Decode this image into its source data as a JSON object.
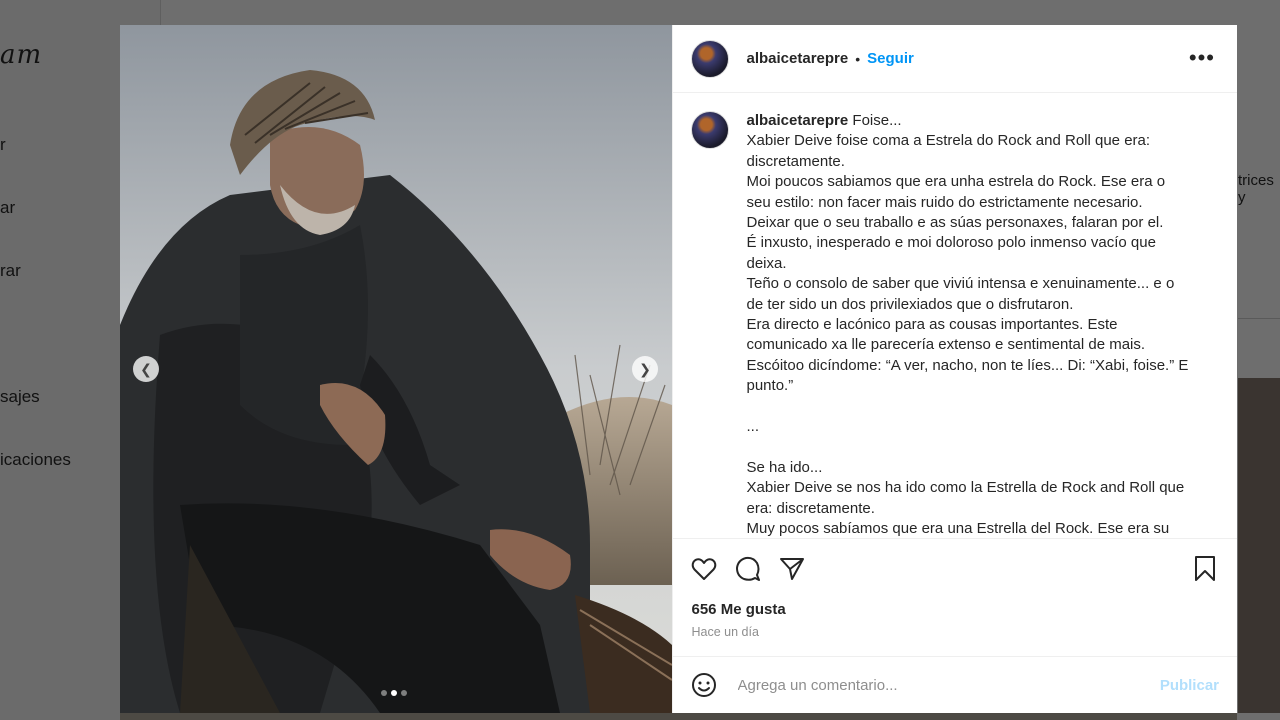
{
  "background": {
    "logo_partial": "am",
    "nav_items": [
      "r",
      "ar",
      "rar",
      "sajes",
      "icaciones"
    ],
    "right_snippet": "trices y"
  },
  "post": {
    "username": "albaicetarepre",
    "follow_label": "Seguir",
    "more_icon": "more-horizontal-icon",
    "caption_lines": [
      "Xabier Deive foise coma a Estrela do Rock and Roll que era:",
      "discretamente.",
      "Moi poucos sabiamos que era unha estrela do Rock. Ese era o",
      "seu estilo: non facer mais ruido do estrictamente necesario.",
      "Deixar que o seu traballo e as súas personaxes, falaran por el.",
      "É inxusto, inesperado e moi doloroso polo inmenso vacío que",
      "deixa.",
      "Teño o consolo de saber que viviú intensa e xenuinamente... e o",
      "de ter sido un dos privilexiados que o disfrutaron.",
      "Era directo e lacónico para as cousas importantes. Este",
      "comunicado xa lle parecería extenso e sentimental de mais.",
      "Escóitoo dicíndome: “A ver, nacho, non te líes... Di: “Xabi, foise.” E",
      "punto.”",
      "",
      "...",
      "",
      "Se ha ido...",
      "Xabier Deive se nos ha ido como la Estrella de Rock and Roll que",
      "era: discretamente.",
      "Muy pocos sabíamos que era una Estrella del Rock. Ese era su"
    ],
    "caption_first": "Foise...",
    "likes": "656 Me gusta",
    "time_ago": "Hace un día",
    "comment_placeholder": "Agrega un comentario...",
    "publish_label": "Publicar",
    "carousel": {
      "total": 3,
      "active": 2
    }
  },
  "colors": {
    "accent": "#0095f6",
    "publish_disabled": "#b2dffc",
    "overlay": "#6e6e6e"
  }
}
